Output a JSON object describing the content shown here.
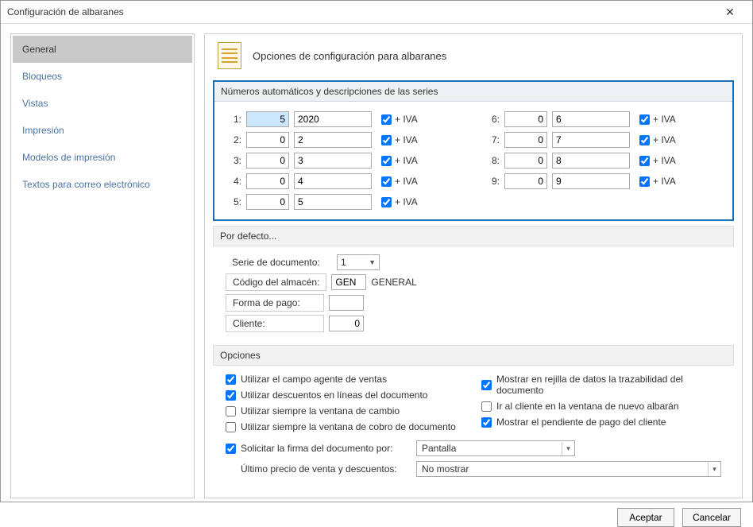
{
  "window": {
    "title": "Configuración de albaranes"
  },
  "nav": {
    "items": [
      {
        "label": "General",
        "active": true
      },
      {
        "label": "Bloqueos"
      },
      {
        "label": "Vistas"
      },
      {
        "label": "Impresión"
      },
      {
        "label": "Modelos de impresión"
      },
      {
        "label": "Textos para correo electrónico"
      }
    ]
  },
  "header": {
    "title": "Opciones de configuración para albaranes"
  },
  "series": {
    "title": "Números automáticos y descripciones de las series",
    "iva_label": "+ IVA",
    "left": [
      {
        "label": "1:",
        "num": "5",
        "desc": "2020",
        "iva": true,
        "selected": true
      },
      {
        "label": "2:",
        "num": "0",
        "desc": "2",
        "iva": true
      },
      {
        "label": "3:",
        "num": "0",
        "desc": "3",
        "iva": true
      },
      {
        "label": "4:",
        "num": "0",
        "desc": "4",
        "iva": true
      },
      {
        "label": "5:",
        "num": "0",
        "desc": "5",
        "iva": true
      }
    ],
    "right": [
      {
        "label": "6:",
        "num": "0",
        "desc": "6",
        "iva": true
      },
      {
        "label": "7:",
        "num": "0",
        "desc": "7",
        "iva": true
      },
      {
        "label": "8:",
        "num": "0",
        "desc": "8",
        "iva": true
      },
      {
        "label": "9:",
        "num": "0",
        "desc": "9",
        "iva": true
      }
    ]
  },
  "defaults": {
    "title": "Por defecto...",
    "serie_label": "Serie de documento:",
    "serie_value": "1",
    "almacen_label": "Código del almacén:",
    "almacen_code": "GEN",
    "almacen_desc": "GENERAL",
    "forma_label": "Forma de pago:",
    "forma_value": "",
    "cliente_label": "Cliente:",
    "cliente_value": "0"
  },
  "options": {
    "title": "Opciones",
    "left": [
      {
        "label": "Utilizar el campo agente de ventas",
        "checked": true
      },
      {
        "label": "Utilizar descuentos en líneas del documento",
        "checked": true
      },
      {
        "label": "Utilizar siempre la ventana de cambio",
        "checked": false
      },
      {
        "label": "Utilizar siempre la ventana de cobro de documento",
        "checked": false
      }
    ],
    "right": [
      {
        "label": "Mostrar en rejilla de datos la trazabilidad del documento",
        "checked": true
      },
      {
        "label": "Ir al cliente en la ventana de nuevo albarán",
        "checked": false
      },
      {
        "label": "Mostrar el pendiente de pago del cliente",
        "checked": true
      }
    ],
    "firma": {
      "label": "Solicitar la firma del documento por:",
      "checked": true,
      "value": "Pantalla"
    },
    "precio": {
      "label": "Último precio de venta y descuentos:",
      "value": "No mostrar"
    }
  },
  "footer": {
    "accept": "Aceptar",
    "cancel": "Cancelar"
  }
}
